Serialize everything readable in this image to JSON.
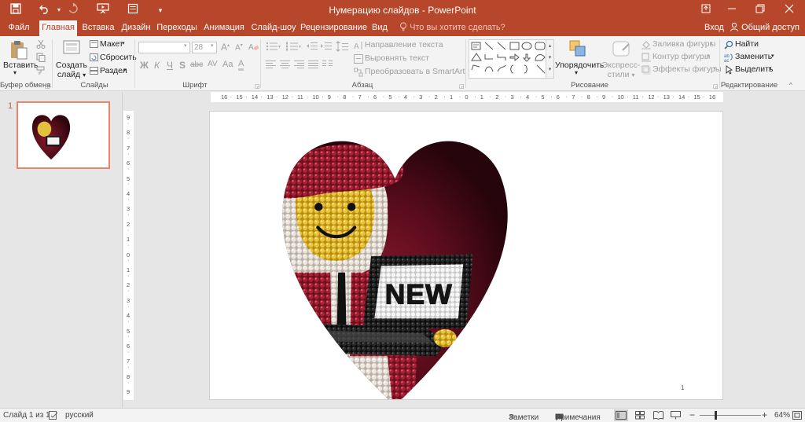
{
  "window": {
    "title": "Нумерацию слайдов - PowerPoint"
  },
  "tabs": [
    {
      "label": "Файл"
    },
    {
      "label": "Главная"
    },
    {
      "label": "Вставка"
    },
    {
      "label": "Дизайн"
    },
    {
      "label": "Переходы"
    },
    {
      "label": "Анимация"
    },
    {
      "label": "Слайд-шоу"
    },
    {
      "label": "Рецензирование"
    },
    {
      "label": "Вид"
    }
  ],
  "tellme": "Что вы хотите сделать?",
  "account": {
    "signin": "Вход",
    "share": "Общий доступ"
  },
  "ribbon": {
    "clipboard": {
      "label": "Буфер обмена",
      "paste": "Вставить"
    },
    "slides": {
      "label": "Слайды",
      "new_slide_1": "Создать",
      "new_slide_2": "слайд",
      "layout": "Макет",
      "reset": "Сбросить",
      "section": "Раздел"
    },
    "font": {
      "label": "Шрифт",
      "size": "28"
    },
    "paragraph": {
      "label": "Абзац",
      "text_direction": "Направление текста",
      "align_text": "Выровнять текст",
      "smartart": "Преобразовать в SmartArt"
    },
    "drawing": {
      "label": "Рисование",
      "arrange": "Упорядочить",
      "quick_styles_1": "Экспресс-",
      "quick_styles_2": "стили",
      "shape_fill": "Заливка фигуры",
      "shape_outline": "Контур фигуры",
      "shape_effects": "Эффекты фигуры"
    },
    "editing": {
      "label": "Редактирование",
      "find": "Найти",
      "replace": "Заменить",
      "select": "Выделить"
    }
  },
  "thumbnails": [
    {
      "number": "1"
    }
  ],
  "ruler_labels": [
    "16",
    "15",
    "14",
    "13",
    "12",
    "11",
    "10",
    "9",
    "8",
    "7",
    "6",
    "5",
    "4",
    "3",
    "2",
    "1",
    "0",
    "1",
    "2",
    "3",
    "4",
    "5",
    "6",
    "7",
    "8",
    "9",
    "10",
    "11",
    "12",
    "13",
    "14",
    "15",
    "16"
  ],
  "vruler_labels": [
    "9",
    "8",
    "7",
    "6",
    "5",
    "4",
    "3",
    "2",
    "1",
    "0",
    "1",
    "2",
    "3",
    "4",
    "5",
    "6",
    "7",
    "8",
    "9"
  ],
  "slide": {
    "page_number": "1",
    "picture_text": "NEW"
  },
  "status": {
    "slide": "Слайд 1 из 1",
    "language": "русский",
    "notes": "Заметки",
    "comments": "Примечания",
    "zoom": "64%"
  },
  "colors": {
    "accent": "#b7472a",
    "heart_dark": "#3a0711",
    "heart_light": "#8b1a2c"
  }
}
